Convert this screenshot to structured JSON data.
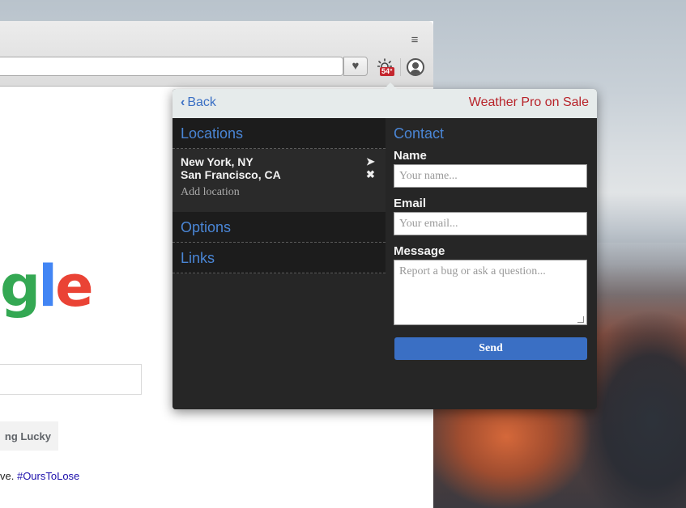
{
  "google": {
    "logo_fragment": [
      "g",
      "l",
      "e"
    ],
    "lucky_label": "ng Lucky",
    "promo_text": "ve. ",
    "promo_link": "#OursToLose"
  },
  "toolbar": {
    "temperature": "54°"
  },
  "popup": {
    "back_label": "Back",
    "promo_label": "Weather Pro on Sale",
    "locations_heading": "Locations",
    "locations": [
      {
        "name": "New York, NY",
        "icon": "location-arrow-icon"
      },
      {
        "name": "San Francisco, CA",
        "icon": "close-icon"
      }
    ],
    "add_location": "Add location",
    "options_heading": "Options",
    "links_heading": "Links",
    "contact": {
      "heading": "Contact",
      "name_label": "Name",
      "name_placeholder": "Your name...",
      "email_label": "Email",
      "email_placeholder": "Your email...",
      "message_label": "Message",
      "message_placeholder": "Report a bug or ask a question...",
      "send_label": "Send"
    }
  },
  "colors": {
    "accent_blue": "#3a6fc4",
    "sale_red": "#b8232a",
    "popup_bg": "#262626"
  }
}
